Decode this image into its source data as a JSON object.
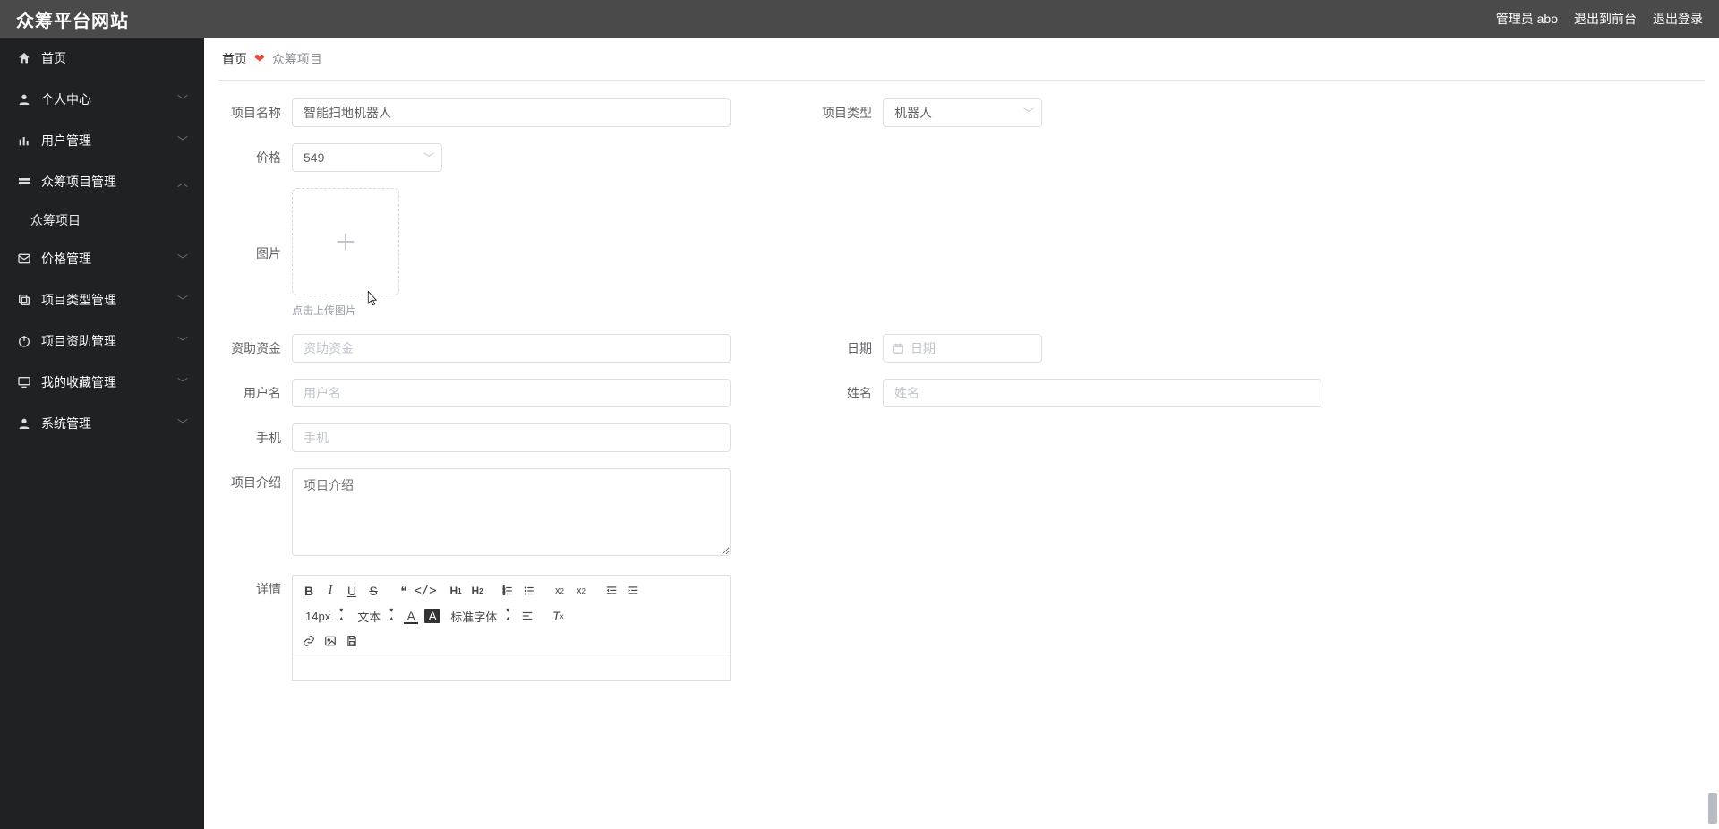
{
  "header": {
    "brand": "众筹平台网站",
    "admin_label": "管理员 abo",
    "to_front_label": "退出到前台",
    "logout_label": "退出登录"
  },
  "sidebar": {
    "items": [
      {
        "icon": "home",
        "label": "首页",
        "expandable": false
      },
      {
        "icon": "person",
        "label": "个人中心",
        "expandable": true
      },
      {
        "icon": "bars",
        "label": "用户管理",
        "expandable": true
      },
      {
        "icon": "grid",
        "label": "众筹项目管理",
        "expandable": true,
        "open": true,
        "children": [
          {
            "label": "众筹项目"
          }
        ]
      },
      {
        "icon": "mail",
        "label": "价格管理",
        "expandable": true
      },
      {
        "icon": "copy",
        "label": "项目类型管理",
        "expandable": true
      },
      {
        "icon": "power",
        "label": "项目资助管理",
        "expandable": true
      },
      {
        "icon": "monitor",
        "label": "我的收藏管理",
        "expandable": true
      },
      {
        "icon": "user",
        "label": "系统管理",
        "expandable": true
      }
    ]
  },
  "breadcrumb": {
    "home": "首页",
    "current": "众筹项目"
  },
  "form": {
    "project_name": {
      "label": "项目名称",
      "value": "智能扫地机器人"
    },
    "project_type": {
      "label": "项目类型",
      "value": "机器人"
    },
    "price": {
      "label": "价格",
      "value": "549"
    },
    "image": {
      "label": "图片",
      "hint": "点击上传图片"
    },
    "fund": {
      "label": "资助资金",
      "placeholder": "资助资金"
    },
    "date": {
      "label": "日期",
      "placeholder": "日期"
    },
    "username": {
      "label": "用户名",
      "placeholder": "用户名"
    },
    "name": {
      "label": "姓名",
      "placeholder": "姓名"
    },
    "phone": {
      "label": "手机",
      "placeholder": "手机"
    },
    "intro": {
      "label": "项目介绍",
      "placeholder": "项目介绍"
    },
    "detail": {
      "label": "详情"
    }
  },
  "editor": {
    "font_size": "14px",
    "block_type": "文本",
    "font_family": "标准字体"
  }
}
